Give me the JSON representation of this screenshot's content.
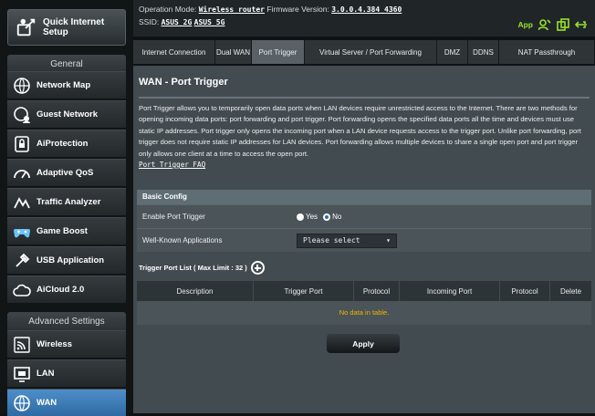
{
  "sidebar": {
    "qis_label": "Quick Internet Setup",
    "general_heading": "General",
    "general_items": [
      {
        "label": "Network Map",
        "icon": "network-map-icon"
      },
      {
        "label": "Guest Network",
        "icon": "guest-network-icon"
      },
      {
        "label": "AiProtection",
        "icon": "shield-icon"
      },
      {
        "label": "Adaptive QoS",
        "icon": "gauge-icon"
      },
      {
        "label": "Traffic Analyzer",
        "icon": "traffic-icon"
      },
      {
        "label": "Game Boost",
        "icon": "gamepad-icon"
      },
      {
        "label": "USB Application",
        "icon": "usb-icon"
      },
      {
        "label": "AiCloud 2.0",
        "icon": "cloud-icon"
      }
    ],
    "advanced_heading": "Advanced Settings",
    "advanced_items": [
      {
        "label": "Wireless",
        "icon": "wifi-icon"
      },
      {
        "label": "LAN",
        "icon": "lan-icon"
      },
      {
        "label": "WAN",
        "icon": "globe-icon",
        "active": true
      }
    ]
  },
  "header": {
    "op_mode_label": "Operation Mode:",
    "op_mode_value": "Wireless router",
    "fw_label": "Firmware Version:",
    "fw_value": "3.0.0.4.384_4360",
    "ssid_label": "SSID:",
    "ssid_2g": "ASUS_2G",
    "ssid_5g": "ASUS_5G",
    "app_label": "App"
  },
  "tabs": [
    {
      "label": "Internet Connection"
    },
    {
      "label": "Dual WAN"
    },
    {
      "label": "Port Trigger",
      "active": true
    },
    {
      "label": "Virtual Server / Port Forwarding"
    },
    {
      "label": "DMZ"
    },
    {
      "label": "DDNS"
    },
    {
      "label": "NAT Passthrough"
    }
  ],
  "main": {
    "title": "WAN - Port Trigger",
    "description": "Port Trigger allows you to temporarily open data ports when LAN devices require unrestricted access to the Internet. There are two methods for opening incoming data ports: port forwarding and port trigger. Port forwarding opens the specified data ports all the time and devices must use static IP addresses. Port trigger only opens the incoming port when a LAN device requests access to the trigger port. Unlike port forwarding, port trigger does not require static IP addresses for LAN devices. Port forwarding allows multiple devices to share a single open port and port trigger only allows one client at a time to access the open port.",
    "faq_link": "Port Trigger FAQ",
    "basic_config": {
      "heading": "Basic Config",
      "enable_label": "Enable Port Trigger",
      "yes_label": "Yes",
      "no_label": "No",
      "selected": "No",
      "apps_label": "Well-Known Applications",
      "apps_value": "Please select"
    },
    "list_title": "Trigger Port List ( Max Limit : 32 )",
    "table": {
      "columns": [
        "Description",
        "Trigger Port",
        "Protocol",
        "Incoming Port",
        "Protocol",
        "Delete"
      ],
      "empty_text": "No data in table."
    },
    "apply_label": "Apply"
  },
  "colors": {
    "accent_yellow": "#f2b500",
    "app_green": "#9be12c",
    "active_nav": "#3b7dbd"
  }
}
